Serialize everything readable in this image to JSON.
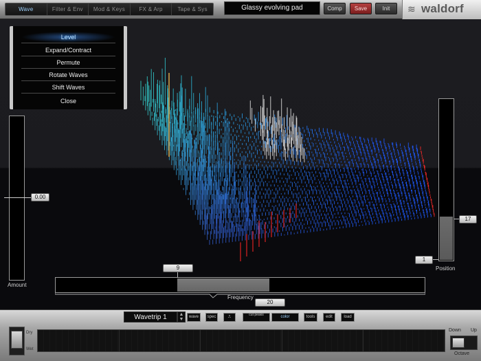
{
  "header": {
    "tabs": [
      {
        "label": "Wave",
        "active": true
      },
      {
        "label": "Filter & Env",
        "active": false
      },
      {
        "label": "Mod & Keys",
        "active": false
      },
      {
        "label": "FX & Arp",
        "active": false
      },
      {
        "label": "Tape & Sys",
        "active": false
      }
    ],
    "patch_name": "Glassy evolving pad",
    "buttons": {
      "comp": "Comp",
      "save": "Save",
      "init": "Init"
    },
    "logo": "waldorf",
    "logo_mark": "≋"
  },
  "menu": {
    "items": [
      "Level",
      "Expand/Contract",
      "Permute",
      "Rotate Waves",
      "Shift Waves",
      "Close"
    ],
    "active_index": 0
  },
  "amount": {
    "label": "Amount",
    "value": "0.00"
  },
  "position": {
    "label": "Position",
    "value_top": "17",
    "value_bottom": "1"
  },
  "frequency": {
    "label": "Frequency",
    "low": "9",
    "high": "20"
  },
  "wavetrip": {
    "name": "Wavetrip 1",
    "spinner_up": "▲",
    "spinner_down": "▼",
    "buttons": [
      "wave",
      "spec",
      "⎍",
      "cut peaks",
      "color",
      "tools",
      "edit",
      "load"
    ]
  },
  "mixer": {
    "dry": "Dry",
    "wet": "Wet"
  },
  "octave": {
    "label": "Octave",
    "down": "Down",
    "up": "Up"
  },
  "colors": {
    "accent": "#9fd3ff",
    "save": "#b54040",
    "spectrum_cold": "#2a4cff",
    "spectrum_hot": "#ff2a2a"
  }
}
